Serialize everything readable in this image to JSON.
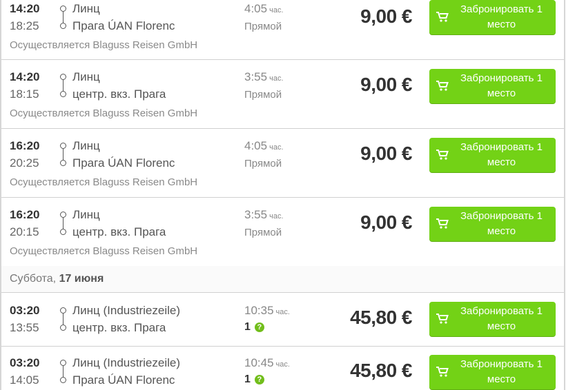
{
  "colors": {
    "accent_green": "#73d216",
    "text_dark": "#333333",
    "text_muted": "#888888"
  },
  "icons": {
    "cart": "shopping-cart-icon",
    "help": "question-circle-icon"
  },
  "units": {
    "hours": "час."
  },
  "book_label": "Забронировать 1 место",
  "day_header": {
    "weekday": "Суббота,",
    "date": "17 июня"
  },
  "trips": [
    {
      "dep": "14:20",
      "arr": "18:25",
      "from": "Линц",
      "to": "Прага ÚAN Florenc",
      "duration": "4:05",
      "direct": "Прямой",
      "price": "9,00 €",
      "operator": "Осуществляется Blaguss Reisen GmbH"
    },
    {
      "dep": "14:20",
      "arr": "18:15",
      "from": "Линц",
      "to": "центр. вкз. Прага",
      "duration": "3:55",
      "direct": "Прямой",
      "price": "9,00 €",
      "operator": "Осуществляется Blaguss Reisen GmbH"
    },
    {
      "dep": "16:20",
      "arr": "20:25",
      "from": "Линц",
      "to": "Прага ÚAN Florenc",
      "duration": "4:05",
      "direct": "Прямой",
      "price": "9,00 €",
      "operator": "Осуществляется Blaguss Reisen GmbH"
    },
    {
      "dep": "16:20",
      "arr": "20:15",
      "from": "Линц",
      "to": "центр. вкз. Прага",
      "duration": "3:55",
      "direct": "Прямой",
      "price": "9,00 €",
      "operator": "Осуществляется Blaguss Reisen GmbH"
    },
    {
      "dep": "03:20",
      "arr": "13:55",
      "from": "Линц (Industriezeile)",
      "to": "центр. вкз. Прага",
      "duration": "10:35",
      "transfers": "1",
      "price": "45,80 €"
    },
    {
      "dep": "03:20",
      "arr": "14:05",
      "from": "Линц (Industriezeile)",
      "to": "Прага ÚAN Florenc",
      "duration": "10:45",
      "transfers": "1",
      "price": "45,80 €"
    }
  ]
}
